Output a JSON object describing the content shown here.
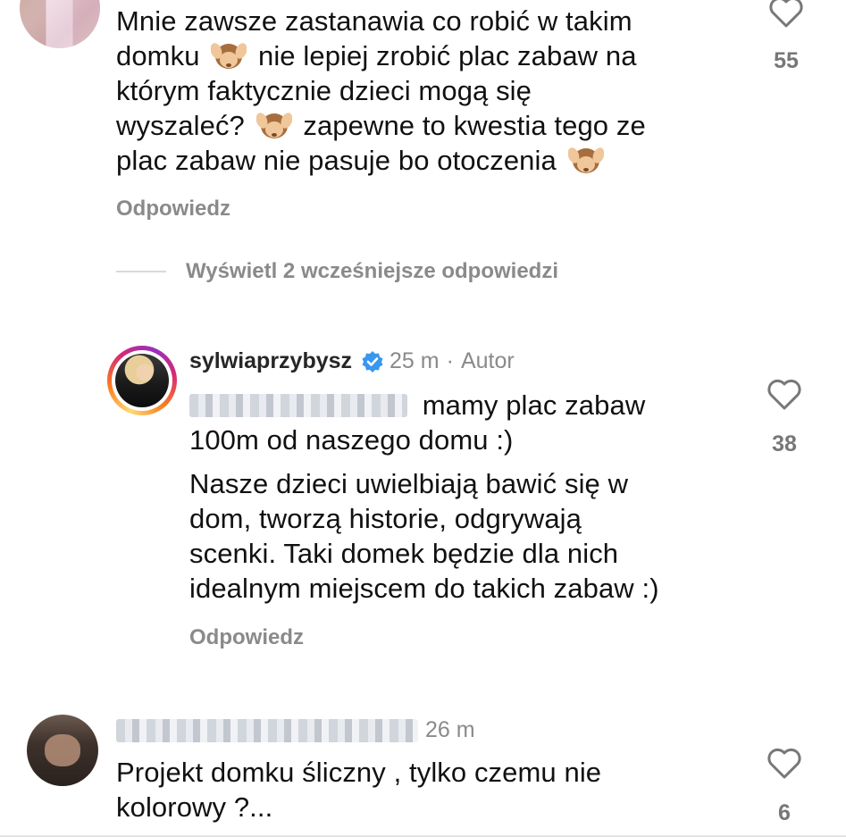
{
  "comments": [
    {
      "id": "c1",
      "text_lines": [
        "Mnie zawsze zastanawia co robić w takim",
        [
          "domku ",
          "emoji",
          " nie lepiej zrobić plac zabaw na"
        ],
        "którym faktycznie dzieci mogą się",
        [
          "wyszaleć? ",
          "emoji",
          " zapewne to kwestia tego ze"
        ],
        [
          "plac zabaw nie pasuje bo otoczenia ",
          "emoji"
        ]
      ],
      "line1": "Mnie zawsze zastanawia co robić w takim",
      "line2a": "domku",
      "line2b": "nie lepiej zrobić plac zabaw na",
      "line3": "którym faktycznie dzieci mogą się",
      "line4a": "wyszaleć?",
      "line4b": "zapewne to kwestia tego ze",
      "line5": "plac zabaw nie pasuje bo otoczenia",
      "emoji": "see-no-evil-monkey",
      "likes": "55",
      "reply_label": "Odpowiedz"
    },
    {
      "id": "c2",
      "username": "sylwiaprzybysz",
      "time": "25 m",
      "separator": "·",
      "badge": "Autor",
      "mention_text": "mamy plac zabaw",
      "line2": "100m od naszego domu :)",
      "p2_line1": "Nasze dzieci uwielbiają bawić się w",
      "p2_line2": "dom, tworzą historie, odgrywają",
      "p2_line3": "scenki. Taki domek będzie dla nich",
      "p2_line4": "idealnym miejscem do takich zabaw :)",
      "likes": "38",
      "reply_label": "Odpowiedz"
    },
    {
      "id": "c3",
      "time": "26 m",
      "line1": "Projekt domku śliczny , tylko czemu nie",
      "line2": "kolorowy ?...",
      "likes": "6"
    }
  ],
  "view_replies": "Wyświetl 2 wcześniejsze odpowiedzi",
  "colors": {
    "verified": "#3897f0",
    "muted": "#8a8a8a",
    "text": "#111111"
  }
}
